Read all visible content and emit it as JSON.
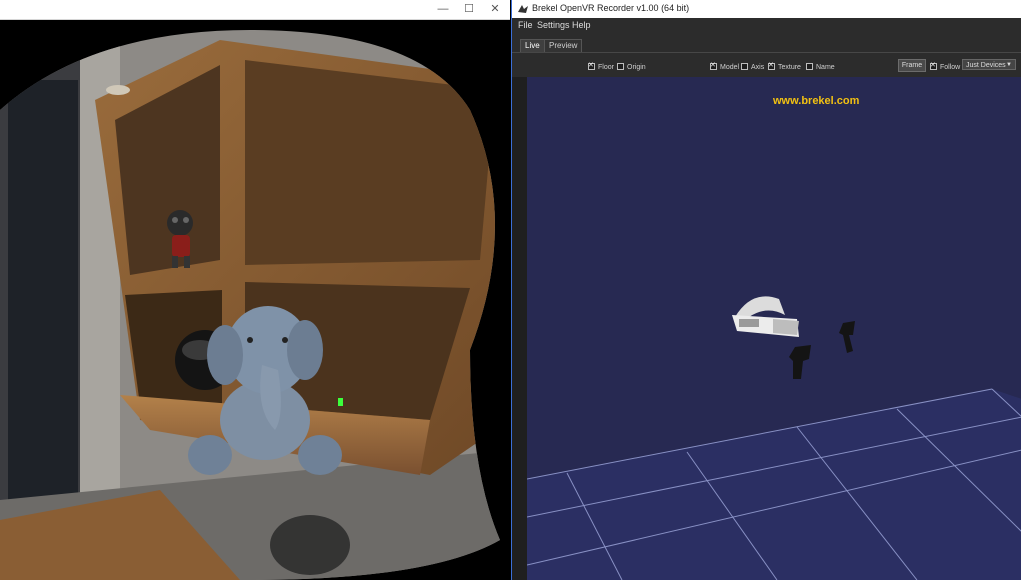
{
  "left_window": {
    "controls": {
      "maximize_glyph": "☐",
      "close_glyph": "✕"
    }
  },
  "right_window": {
    "title": "Brekel OpenVR Recorder v1.00 (64 bit)",
    "menu": [
      "File",
      "Settings",
      "Help"
    ],
    "tabs": [
      {
        "label": "Live",
        "active": true
      },
      {
        "label": "Preview",
        "active": false
      }
    ],
    "toolbar": {
      "floor": {
        "label": "Floor",
        "checked": true
      },
      "origin": {
        "label": "Origin",
        "checked": false
      },
      "model": {
        "label": "Model",
        "checked": true
      },
      "axis": {
        "label": "Axis",
        "checked": false
      },
      "texture": {
        "label": "Texture",
        "checked": true
      },
      "name": {
        "label": "Name",
        "checked": false
      },
      "frame_button": "Frame",
      "follow": {
        "label": "Follow",
        "checked": true
      },
      "device_select": "Just Devices"
    },
    "viewport": {
      "watermark": "www.brekel.com",
      "background_color": "#272952",
      "grid_color": "#8890c4"
    }
  }
}
